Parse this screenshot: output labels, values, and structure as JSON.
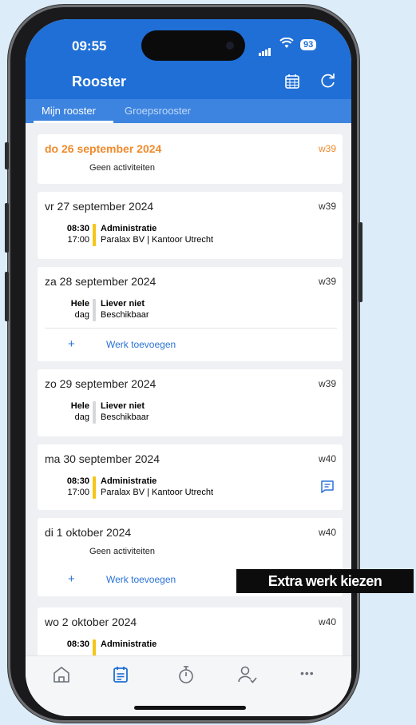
{
  "status": {
    "time": "09:55",
    "battery": "93"
  },
  "app": {
    "title": "Rooster",
    "icons": [
      "calendar-icon",
      "refresh-icon"
    ]
  },
  "tabs": {
    "active": "Mijn rooster",
    "inactive": "Groepsrooster"
  },
  "days": [
    {
      "date": "do 26 september 2024",
      "week": "w39",
      "today": true,
      "none": "Geen activiteiten"
    },
    {
      "date": "vr 27 september 2024",
      "week": "w39",
      "event": {
        "start": "08:30",
        "end": "17:00",
        "title": "Administratie",
        "sub": "Paralax BV | Kantoor Utrecht",
        "color": "#f5c518"
      }
    },
    {
      "date": "za 28 september 2024",
      "week": "w39",
      "event": {
        "start": "Hele",
        "end": "dag",
        "title": "Liever niet",
        "sub": "Beschikbaar",
        "color": "#d6d8db"
      },
      "add": "Werk toevoegen"
    },
    {
      "date": "zo 29 september 2024",
      "week": "w39",
      "event": {
        "start": "Hele",
        "end": "dag",
        "title": "Liever niet",
        "sub": "Beschikbaar",
        "color": "#d6d8db"
      }
    },
    {
      "date": "ma 30 september 2024",
      "week": "w40",
      "event": {
        "start": "08:30",
        "end": "17:00",
        "title": "Administratie",
        "sub": "Paralax BV | Kantoor Utrecht",
        "color": "#f5c518"
      },
      "chat": "chat-icon"
    },
    {
      "date": "di 1 oktober 2024",
      "week": "w40",
      "none": "Geen activiteiten",
      "add": "Werk toevoegen"
    },
    {
      "date": "wo 2 oktober 2024",
      "week": "w40",
      "event": {
        "start": "08:30",
        "title": "Administratie",
        "color": "#f5c518"
      }
    }
  ],
  "add_plus": "+",
  "bottom_nav": [
    "home-icon",
    "schedule-icon",
    "timer-icon",
    "user-check-icon",
    "more-icon"
  ],
  "more_glyph": "•••",
  "overlay": {
    "label": "Extra werk kiezen"
  }
}
